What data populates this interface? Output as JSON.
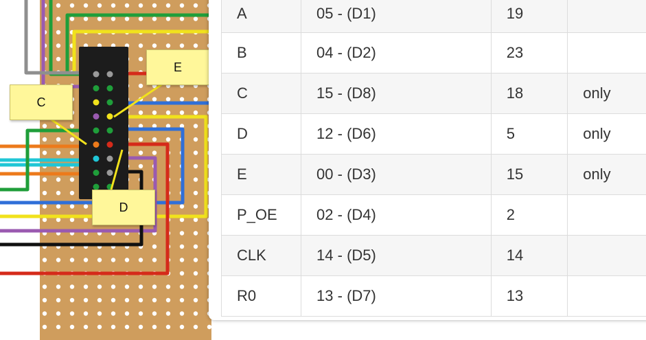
{
  "callouts": {
    "c": "C",
    "d": "D",
    "e": "E"
  },
  "pin_table": {
    "rows": [
      {
        "signal": "A",
        "gpio": "05 - (D1)",
        "pin": "19",
        "note": ""
      },
      {
        "signal": "B",
        "gpio": "04 - (D2)",
        "pin": "23",
        "note": ""
      },
      {
        "signal": "C",
        "gpio": "15 - (D8)",
        "pin": "18",
        "note": "only"
      },
      {
        "signal": "D",
        "gpio": "12 - (D6)",
        "pin": "5",
        "note": "only"
      },
      {
        "signal": "E",
        "gpio": "00 - (D3)",
        "pin": "15",
        "note": "only"
      },
      {
        "signal": "P_OE",
        "gpio": "02 - (D4)",
        "pin": "2",
        "note": ""
      },
      {
        "signal": "CLK",
        "gpio": "14 - (D5)",
        "pin": "14",
        "note": ""
      },
      {
        "signal": "R0",
        "gpio": "13 - (D7)",
        "pin": "13",
        "note": ""
      }
    ]
  },
  "colors": {
    "board": "#cf9d5d",
    "hole": "#ffffff",
    "header": "#1c1c1c",
    "wire_green": "#1f9e3a",
    "wire_yellow": "#f1e21c",
    "wire_red": "#d52a1a",
    "wire_blue": "#2f6fd8",
    "wire_orange": "#ec7a1b",
    "wire_cyan": "#20c6d6",
    "wire_purple": "#9a5ab0",
    "wire_black": "#111111",
    "wire_gray": "#8f8f8f"
  }
}
